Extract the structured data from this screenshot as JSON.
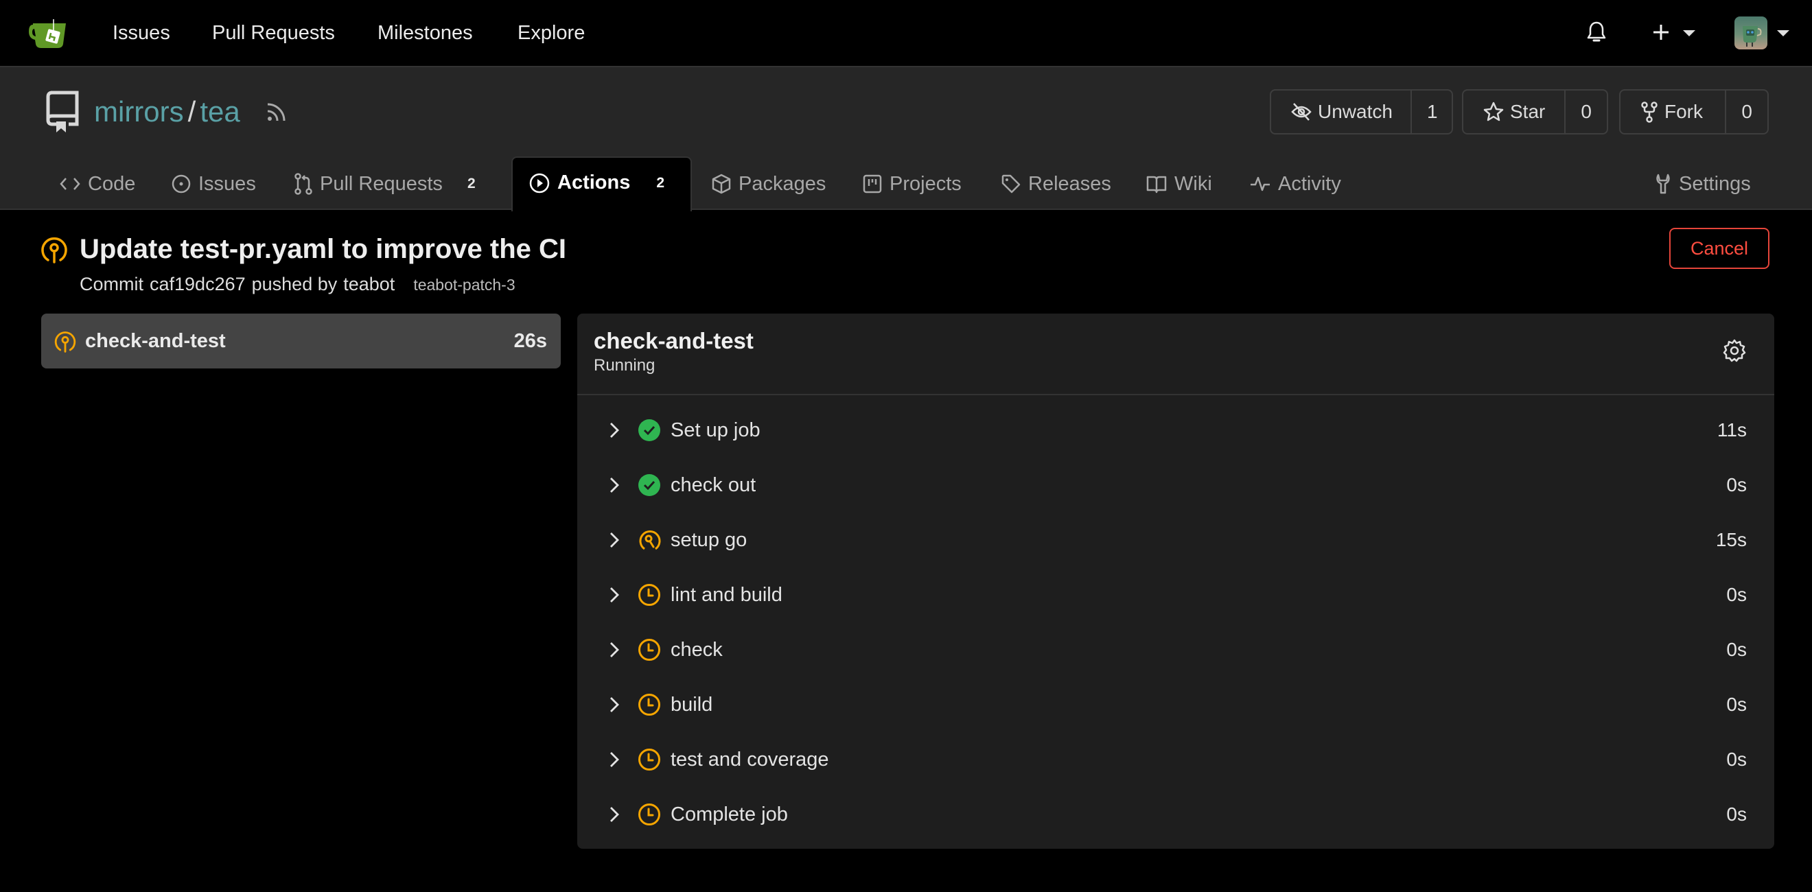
{
  "navbar": {
    "links": [
      "Issues",
      "Pull Requests",
      "Milestones",
      "Explore"
    ],
    "icons": [
      "gitea-logo-icon",
      "bell-icon",
      "plus-icon",
      "avatar"
    ]
  },
  "repo": {
    "owner": "mirrors",
    "separator": "/",
    "name": "tea",
    "watch": {
      "label": "Unwatch",
      "count": "1"
    },
    "star": {
      "label": "Star",
      "count": "0"
    },
    "fork": {
      "label": "Fork",
      "count": "0"
    },
    "tabs": [
      {
        "label": "Code",
        "icon": "code-icon"
      },
      {
        "label": "Issues",
        "icon": "issue-icon"
      },
      {
        "label": "Pull Requests",
        "icon": "pull-request-icon",
        "badge": "2"
      },
      {
        "label": "Actions",
        "icon": "play-icon",
        "badge": "2",
        "active": true
      },
      {
        "label": "Packages",
        "icon": "package-icon"
      },
      {
        "label": "Projects",
        "icon": "project-icon"
      },
      {
        "label": "Releases",
        "icon": "tag-icon"
      },
      {
        "label": "Wiki",
        "icon": "book-icon"
      },
      {
        "label": "Activity",
        "icon": "pulse-icon"
      },
      {
        "label": "Settings",
        "icon": "tools-icon"
      }
    ]
  },
  "run": {
    "title": "Update test-pr.yaml to improve the CI",
    "commit_prefix": "Commit",
    "commit_sha": "caf19dc267",
    "pushed_by_text": "pushed by",
    "author": "teabot",
    "branch": "teabot-patch-3",
    "status": "running",
    "cancel_label": "Cancel"
  },
  "jobs": [
    {
      "name": "check-and-test",
      "duration": "26s",
      "status": "running"
    }
  ],
  "job_detail": {
    "name": "check-and-test",
    "status_text": "Running",
    "steps": [
      {
        "name": "Set up job",
        "duration": "11s",
        "status": "success"
      },
      {
        "name": "check out",
        "duration": "0s",
        "status": "success"
      },
      {
        "name": "setup go",
        "duration": "15s",
        "status": "running"
      },
      {
        "name": "lint and build",
        "duration": "0s",
        "status": "waiting"
      },
      {
        "name": "check",
        "duration": "0s",
        "status": "waiting"
      },
      {
        "name": "build",
        "duration": "0s",
        "status": "waiting"
      },
      {
        "name": "test and coverage",
        "duration": "0s",
        "status": "waiting"
      },
      {
        "name": "Complete job",
        "duration": "0s",
        "status": "waiting"
      }
    ]
  },
  "colors": {
    "accent_running": "#f5a500",
    "success": "#2fb551",
    "danger": "#e5453a",
    "repo_link": "#5aa1a6"
  }
}
